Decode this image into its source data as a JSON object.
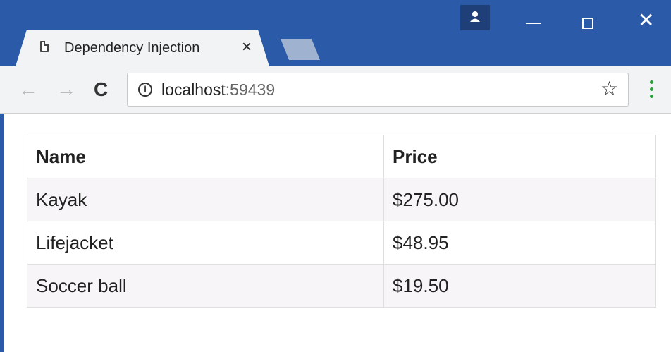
{
  "window": {
    "tab_title": "Dependency Injection",
    "tab_close": "×",
    "close_glyph": "✕"
  },
  "toolbar": {
    "back_glyph": "←",
    "forward_glyph": "→",
    "reload_glyph": "C",
    "info_glyph": "i",
    "url_host": "localhost",
    "url_port": ":59439",
    "star_glyph": "☆"
  },
  "table": {
    "headers": [
      "Name",
      "Price"
    ],
    "rows": [
      [
        "Kayak",
        "$275.00"
      ],
      [
        "Lifejacket",
        "$48.95"
      ],
      [
        "Soccer ball",
        "$19.50"
      ]
    ]
  },
  "colors": {
    "titlebar": "#2b5aa8",
    "toolbar": "#f1f3f4",
    "row_stripe": "#f7f5f7"
  }
}
